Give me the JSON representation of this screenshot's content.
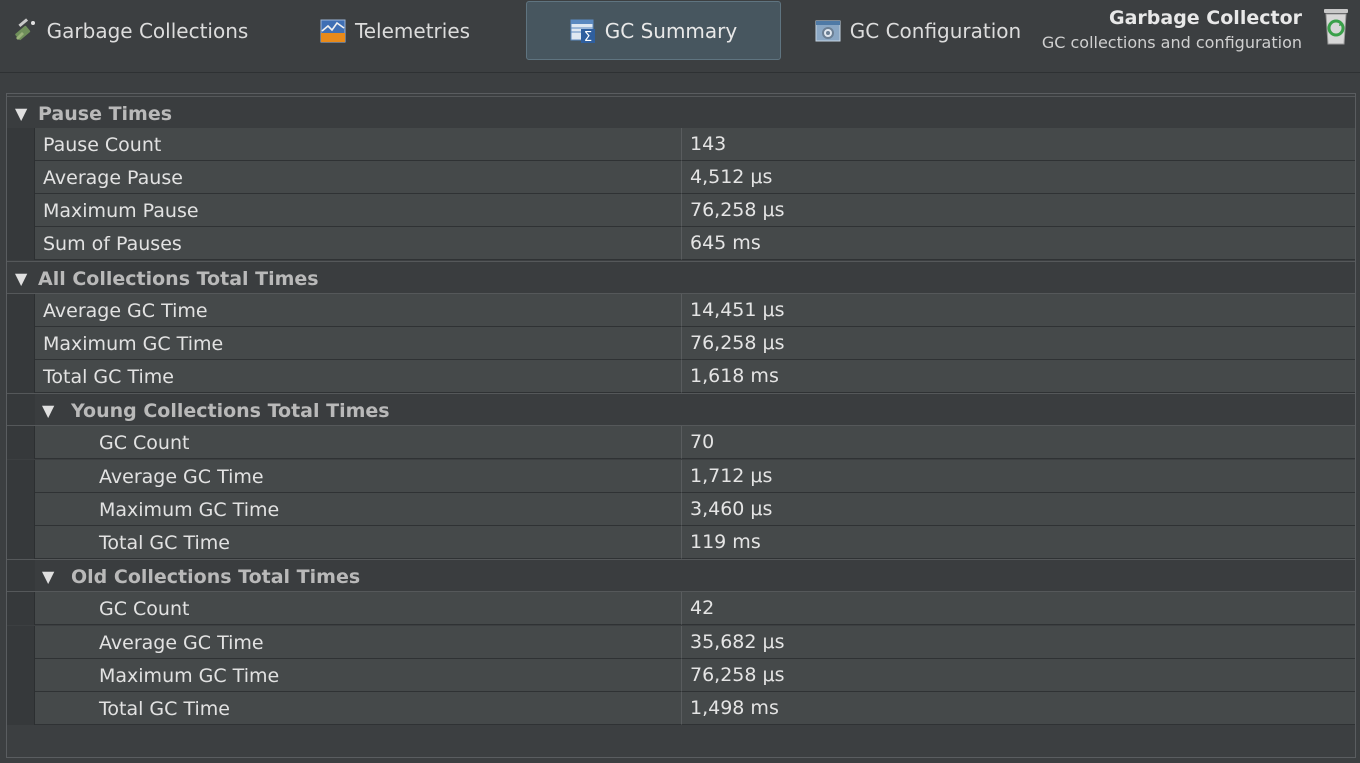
{
  "tabs": [
    {
      "label": "Garbage Collections",
      "icon": "broom-icon"
    },
    {
      "label": "Telemetries",
      "icon": "chart-icon"
    },
    {
      "label": "GC Summary",
      "icon": "sigma-table-icon",
      "active": true
    },
    {
      "label": "GC Configuration",
      "icon": "gear-window-icon"
    }
  ],
  "header": {
    "title": "Garbage Collector",
    "subtitle": "GC collections and configuration",
    "icon": "recycle-bin-icon"
  },
  "colors": {
    "background": "#3c3f41",
    "active_tab": "#47565f",
    "row": "#45494a",
    "section_text": "#b9b9b9"
  },
  "tree": {
    "pause_times": {
      "title": "Pause Times",
      "rows": [
        {
          "name": "Pause Count",
          "value": "143"
        },
        {
          "name": "Average Pause",
          "value": "4,512 μs"
        },
        {
          "name": "Maximum Pause",
          "value": "76,258 μs"
        },
        {
          "name": "Sum of Pauses",
          "value": "645 ms"
        }
      ]
    },
    "all_collections": {
      "title": "All Collections Total Times",
      "rows": [
        {
          "name": "Average GC Time",
          "value": "14,451 μs"
        },
        {
          "name": "Maximum GC Time",
          "value": "76,258 μs"
        },
        {
          "name": "Total GC Time",
          "value": "1,618 ms"
        }
      ]
    },
    "young_collections": {
      "title": "Young Collections Total Times",
      "rows": [
        {
          "name": "GC Count",
          "value": "70"
        },
        {
          "name": "Average GC Time",
          "value": "1,712 μs"
        },
        {
          "name": "Maximum GC Time",
          "value": "3,460 μs"
        },
        {
          "name": "Total GC Time",
          "value": "119 ms"
        }
      ]
    },
    "old_collections": {
      "title": "Old Collections Total Times",
      "rows": [
        {
          "name": "GC Count",
          "value": "42"
        },
        {
          "name": "Average GC Time",
          "value": "35,682 μs"
        },
        {
          "name": "Maximum GC Time",
          "value": "76,258 μs"
        },
        {
          "name": "Total GC Time",
          "value": "1,498 ms"
        }
      ]
    }
  }
}
